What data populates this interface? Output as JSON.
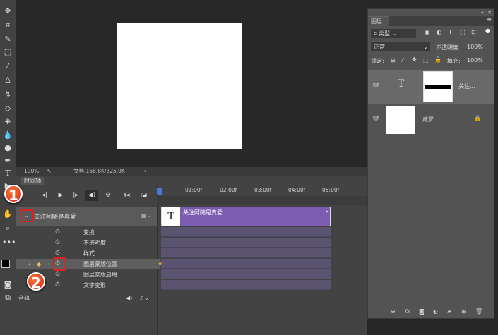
{
  "status": {
    "zoom": "100%",
    "doc": "文档:168.8K/325.9K"
  },
  "timeline": {
    "tab": "时间轴",
    "ticks": [
      "01:00f",
      "02:00f",
      "03:00f",
      "04:00f",
      "05:00f"
    ],
    "layer_name": "关注阿随是真爱",
    "clip_name": "关注阿随是真爱",
    "clip_color": "#7b5cb0",
    "properties": [
      "变换",
      "不透明度",
      "样式",
      "图层蒙版位置",
      "图层蒙版启用",
      "文字变形"
    ],
    "audio": "音轨"
  },
  "annotations": [
    "1",
    "2"
  ],
  "layers_panel": {
    "title": "图层",
    "filter": "类型",
    "blend": "正常",
    "opacity_label": "不透明度:",
    "opacity": "100%",
    "lock_label": "锁定:",
    "fill_label": "填充:",
    "fill": "100%",
    "layers": [
      {
        "name": "关注...",
        "type": "text"
      },
      {
        "name": "背景",
        "type": "background"
      }
    ]
  }
}
